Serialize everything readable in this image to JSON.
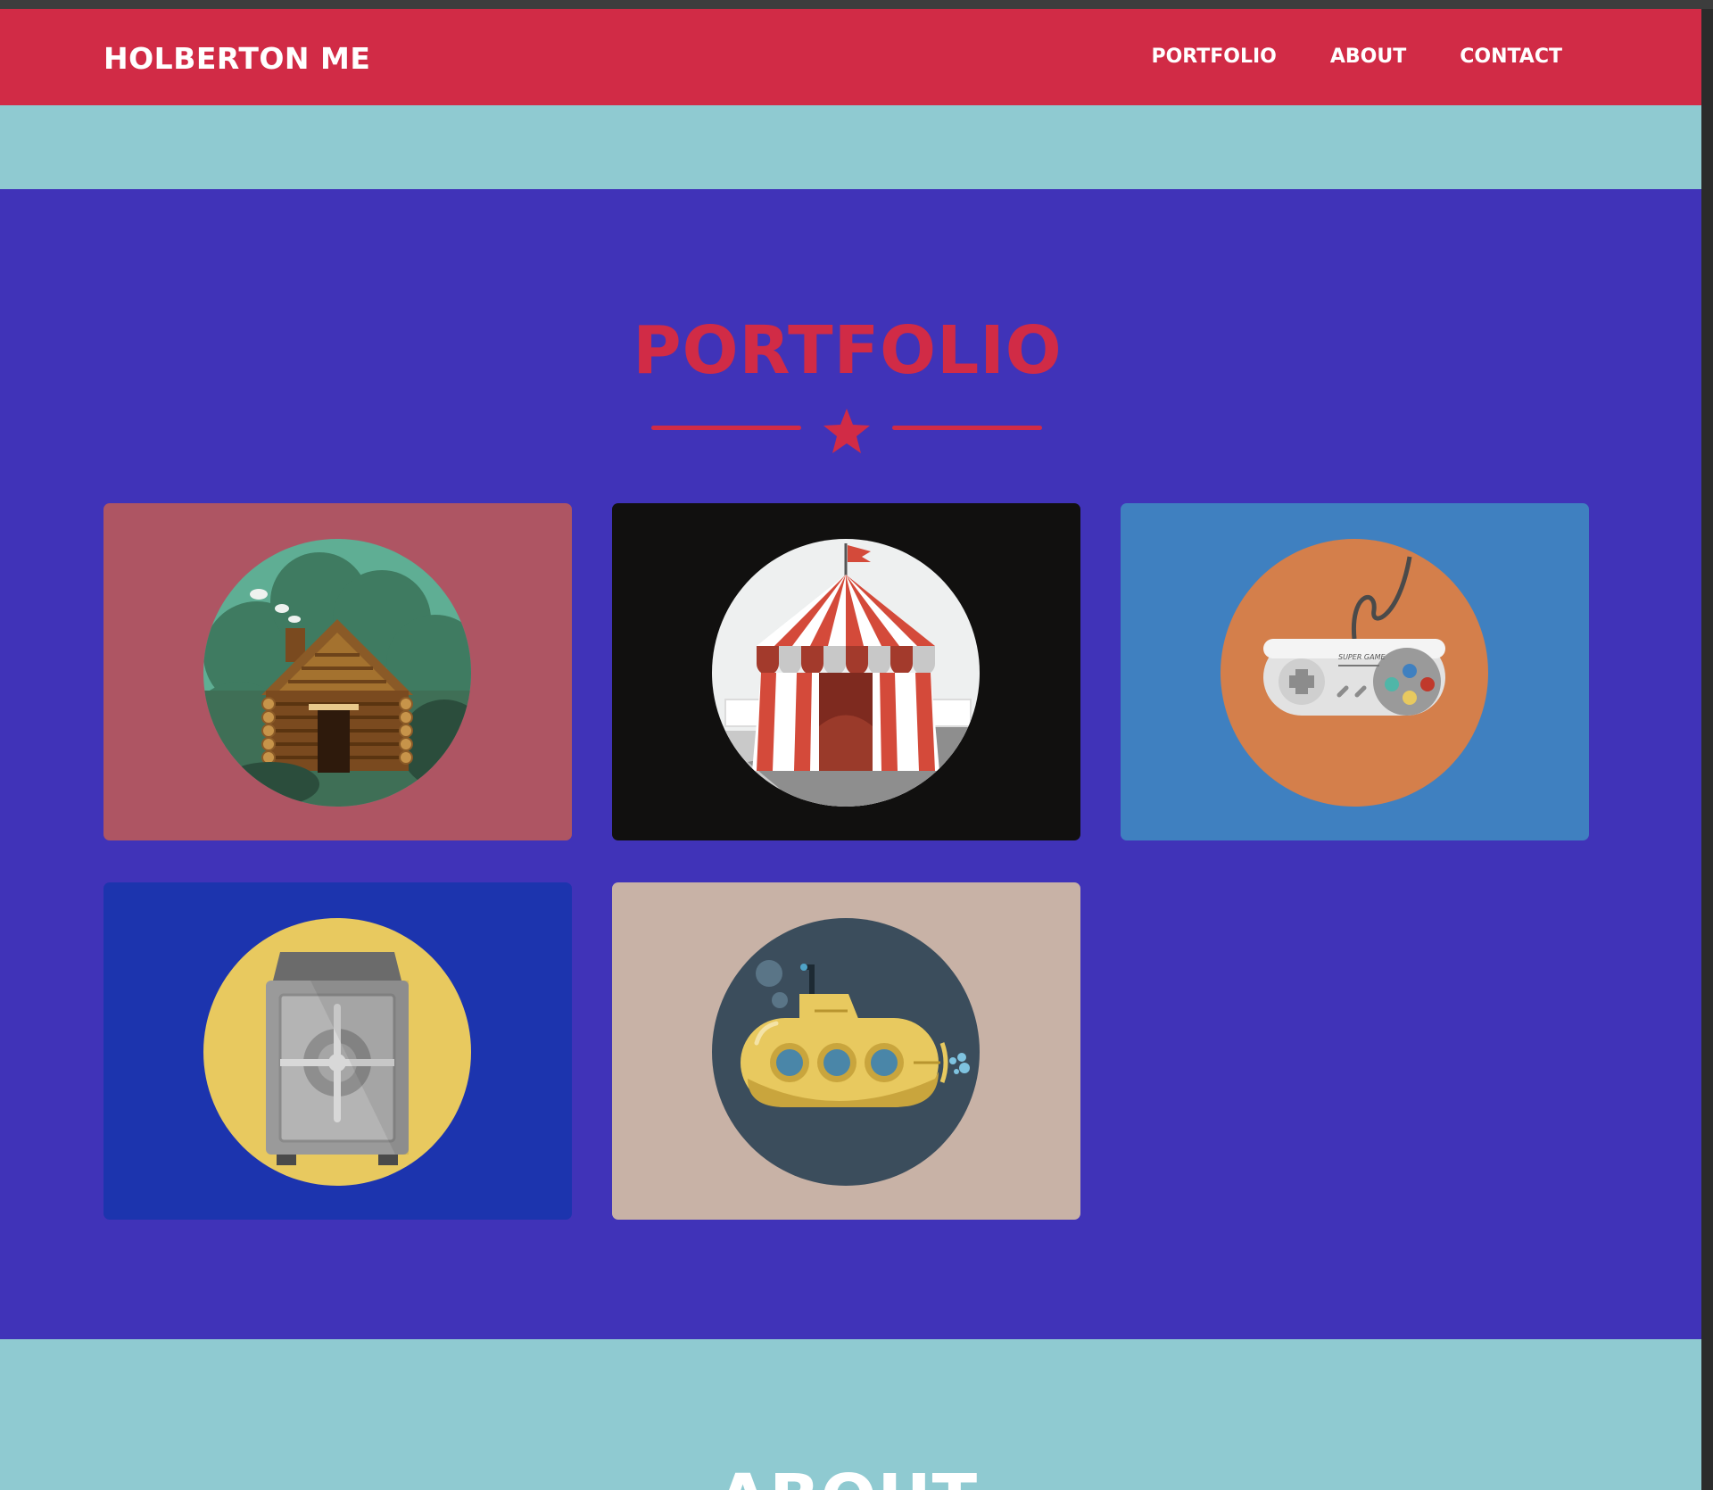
{
  "navbar": {
    "brand": "HOLBERTON ME",
    "links": [
      "PORTFOLIO",
      "ABOUT",
      "CONTACT"
    ]
  },
  "portfolio": {
    "title": "PORTFOLIO",
    "items": [
      {
        "icon": "cabin-icon",
        "bg": "#ae5563",
        "circle": "#3f7b61"
      },
      {
        "icon": "circus-tent-icon",
        "bg": "#11100f",
        "circle": "#eef0f0"
      },
      {
        "icon": "game-controller-icon",
        "bg": "#3f80c0",
        "circle": "#d47f4b"
      },
      {
        "icon": "safe-icon",
        "bg": "#1c34ae",
        "circle": "#e8c95f"
      },
      {
        "icon": "submarine-icon",
        "bg": "#c8b2a6",
        "circle": "#3b4d5c"
      }
    ]
  },
  "about": {
    "title": "ABOUT"
  },
  "colors": {
    "accent": "#d12b46",
    "portfolio_bg": "#4033b8",
    "light_bg": "#8fcad1"
  }
}
